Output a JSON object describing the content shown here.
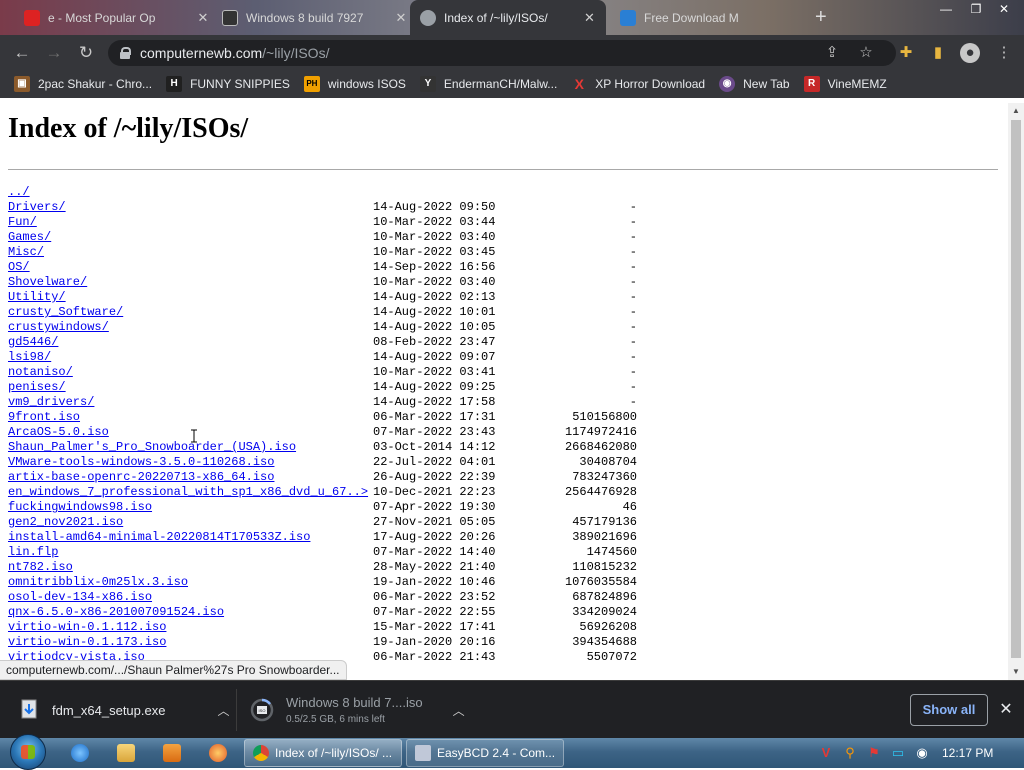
{
  "tabs": [
    {
      "label": "e - Most Popular Op",
      "favicon": "#d22"
    },
    {
      "label": "Windows 8 build 7927",
      "favicon": "#333"
    },
    {
      "label": "Index of /~lily/ISOs/",
      "favicon": "#9aa0a6",
      "active": true
    },
    {
      "label": "Free Download M",
      "favicon": "#2a7fd4"
    }
  ],
  "toolbar": {
    "url_host": "computernewb.com",
    "url_path": "/~lily/ISOs/"
  },
  "bookmarks": [
    {
      "label": "2pac Shakur - Chro...",
      "color": "#8b5a2b",
      "glyph": "▣"
    },
    {
      "label": "FUNNY SNIPPIES",
      "color": "#202020",
      "glyph": "H"
    },
    {
      "label": "windows ISOS",
      "color": "#f0a000",
      "glyph": "PH"
    },
    {
      "label": "EndermanCH/Malw...",
      "color": "#333333",
      "glyph": "Y"
    },
    {
      "label": "XP Horror Download",
      "color": "#35363a",
      "glyph": "X"
    },
    {
      "label": "New Tab",
      "color": "#6a4a8a",
      "glyph": "◉"
    },
    {
      "label": "VineMEMZ",
      "color": "#c62828",
      "glyph": "R"
    }
  ],
  "page": {
    "title": "Index of /~lily/ISOs/",
    "entries": [
      {
        "name": "../",
        "date": "",
        "size": ""
      },
      {
        "name": "Drivers/",
        "date": "14-Aug-2022 09:50",
        "size": "-"
      },
      {
        "name": "Fun/",
        "date": "10-Mar-2022 03:44",
        "size": "-"
      },
      {
        "name": "Games/",
        "date": "10-Mar-2022 03:40",
        "size": "-"
      },
      {
        "name": "Misc/",
        "date": "10-Mar-2022 03:45",
        "size": "-"
      },
      {
        "name": "OS/",
        "date": "14-Sep-2022 16:56",
        "size": "-"
      },
      {
        "name": "Shovelware/",
        "date": "10-Mar-2022 03:40",
        "size": "-"
      },
      {
        "name": "Utility/",
        "date": "14-Aug-2022 02:13",
        "size": "-"
      },
      {
        "name": "crusty_Software/",
        "date": "14-Aug-2022 10:01",
        "size": "-"
      },
      {
        "name": "crustywindows/",
        "date": "14-Aug-2022 10:05",
        "size": "-"
      },
      {
        "name": "gd5446/",
        "date": "08-Feb-2022 23:47",
        "size": "-"
      },
      {
        "name": "lsi98/",
        "date": "14-Aug-2022 09:07",
        "size": "-"
      },
      {
        "name": "notaniso/",
        "date": "10-Mar-2022 03:41",
        "size": "-"
      },
      {
        "name": "penises/",
        "date": "14-Aug-2022 09:25",
        "size": "-"
      },
      {
        "name": "vm9_drivers/",
        "date": "14-Aug-2022 17:58",
        "size": "-"
      },
      {
        "name": "9front.iso",
        "date": "06-Mar-2022 17:31",
        "size": "510156800"
      },
      {
        "name": "ArcaOS-5.0.iso",
        "date": "07-Mar-2022 23:43",
        "size": "1174972416"
      },
      {
        "name": "Shaun_Palmer's_Pro_Snowboarder_(USA).iso",
        "date": "03-Oct-2014 14:12",
        "size": "2668462080"
      },
      {
        "name": "VMware-tools-windows-3.5.0-110268.iso",
        "date": "22-Jul-2022 04:01",
        "size": "30408704"
      },
      {
        "name": "artix-base-openrc-20220713-x86_64.iso",
        "date": "26-Aug-2022 22:39",
        "size": "783247360"
      },
      {
        "name": "en_windows_7_professional_with_sp1_x86_dvd_u_67..>",
        "date": "10-Dec-2021 22:23",
        "size": "2564476928"
      },
      {
        "name": "fuckingwindows98.iso",
        "date": "07-Apr-2022 19:30",
        "size": "46"
      },
      {
        "name": "gen2_nov2021.iso",
        "date": "27-Nov-2021 05:05",
        "size": "457179136"
      },
      {
        "name": "install-amd64-minimal-20220814T170533Z.iso",
        "date": "17-Aug-2022 20:26",
        "size": "389021696"
      },
      {
        "name": "lin.flp",
        "date": "07-Mar-2022 14:40",
        "size": "1474560"
      },
      {
        "name": "nt782.iso",
        "date": "28-May-2022 21:40",
        "size": "110815232"
      },
      {
        "name": "omnitribblix-0m25lx.3.iso",
        "date": "19-Jan-2022 10:46",
        "size": "1076035584"
      },
      {
        "name": "osol-dev-134-x86.iso",
        "date": "06-Mar-2022 23:52",
        "size": "687824896"
      },
      {
        "name": "qnx-6.5.0-x86-201007091524.iso",
        "date": "07-Mar-2022 22:55",
        "size": "334209024"
      },
      {
        "name": "virtio-win-0.1.112.iso",
        "date": "15-Mar-2022 17:41",
        "size": "56926208"
      },
      {
        "name": "virtio-win-0.1.173.iso",
        "date": "19-Jan-2020 20:16",
        "size": "394354688"
      },
      {
        "name": "virtiodcv-vista.iso",
        "date": "06-Mar-2022 21:43",
        "size": "5507072"
      }
    ]
  },
  "status": {
    "text": "computernewb.com/.../Shaun Palmer%27s Pro Snowboarder..."
  },
  "downloads": {
    "items": [
      {
        "name": "fdm_x64_setup.exe",
        "sub": ""
      },
      {
        "name": "Windows 8 build 7....iso",
        "sub": "0.5/2.5 GB, 6 mins left"
      }
    ],
    "show_all": "Show all"
  },
  "taskbar": {
    "buttons": [
      {
        "label": "Index of /~lily/ISOs/ ...",
        "active": true
      },
      {
        "label": "EasyBCD 2.4 - Com...",
        "active": false
      }
    ],
    "clock": "12:17 PM"
  },
  "colors": {
    "link": "#0000ee",
    "chrome_dark": "#35363a",
    "show_all_text": "#8ab4f8"
  }
}
